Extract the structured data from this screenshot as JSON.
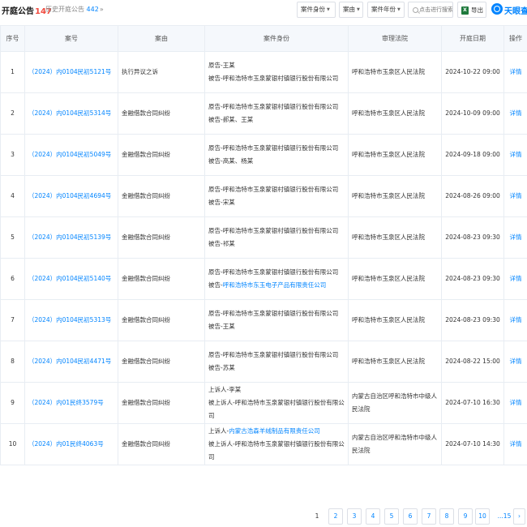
{
  "header": {
    "title": "开庭公告",
    "count": "147",
    "history_label": "历史开庭公告",
    "history_count": "442",
    "history_chevron": "»",
    "filters": [
      {
        "label": "案件身份"
      },
      {
        "label": "案由"
      },
      {
        "label": "案件年份"
      }
    ],
    "search_placeholder": "点击进行搜索",
    "export_label": "导出",
    "export_icon": "excel-icon",
    "logo_text": "天眼查",
    "accent_color": "#0084ff",
    "count_color": "#f04a3e"
  },
  "table": {
    "columns": [
      "序号",
      "案号",
      "案由",
      "案件身份",
      "审理法院",
      "开庭日期",
      "操作"
    ],
    "rows": [
      {
        "index": "1",
        "case_no": "（2024）内0104民初5121号",
        "cause": "执行异议之诉",
        "parties": [
          {
            "role": "原告-王某",
            "entity": ""
          },
          {
            "role": "被告-呼和浩特市玉泉蒙银村镇银行股份有限公司",
            "entity": ""
          }
        ],
        "court": "呼和浩特市玉泉区人民法院",
        "date": "2024-10-22 09:00",
        "action": "详情"
      },
      {
        "index": "2",
        "case_no": "（2024）内0104民初5314号",
        "cause": "金融借款合同纠纷",
        "parties": [
          {
            "role": "原告-呼和浩特市玉泉蒙银村镇银行股份有限公司",
            "entity": ""
          },
          {
            "role": "被告-郝某、王某",
            "entity": ""
          }
        ],
        "court": "呼和浩特市玉泉区人民法院",
        "date": "2024-10-09 09:00",
        "action": "详情"
      },
      {
        "index": "3",
        "case_no": "（2024）内0104民初5049号",
        "cause": "金融借款合同纠纷",
        "parties": [
          {
            "role": "原告-呼和浩特市玉泉蒙银村镇银行股份有限公司",
            "entity": ""
          },
          {
            "role": "被告-高某、杨某",
            "entity": ""
          }
        ],
        "court": "呼和浩特市玉泉区人民法院",
        "date": "2024-09-18 09:00",
        "action": "详情"
      },
      {
        "index": "4",
        "case_no": "（2024）内0104民初4694号",
        "cause": "金融借款合同纠纷",
        "parties": [
          {
            "role": "原告-呼和浩特市玉泉蒙银村镇银行股份有限公司",
            "entity": ""
          },
          {
            "role": "被告-宋某",
            "entity": ""
          }
        ],
        "court": "呼和浩特市玉泉区人民法院",
        "date": "2024-08-26 09:00",
        "action": "详情"
      },
      {
        "index": "5",
        "case_no": "（2024）内0104民初5139号",
        "cause": "金融借款合同纠纷",
        "parties": [
          {
            "role": "原告-呼和浩特市玉泉蒙银村镇银行股份有限公司",
            "entity": ""
          },
          {
            "role": "被告-祁某",
            "entity": ""
          }
        ],
        "court": "呼和浩特市玉泉区人民法院",
        "date": "2024-08-23 09:30",
        "action": "详情"
      },
      {
        "index": "6",
        "case_no": "（2024）内0104民初5140号",
        "cause": "金融借款合同纠纷",
        "parties": [
          {
            "role": "原告-呼和浩特市玉泉蒙银村镇银行股份有限公司",
            "entity": ""
          },
          {
            "role": "被告-",
            "entity": "呼和浩特市东玉电子产品有限责任公司"
          }
        ],
        "court": "呼和浩特市玉泉区人民法院",
        "date": "2024-08-23 09:30",
        "action": "详情"
      },
      {
        "index": "7",
        "case_no": "（2024）内0104民初5313号",
        "cause": "金融借款合同纠纷",
        "parties": [
          {
            "role": "原告-呼和浩特市玉泉蒙银村镇银行股份有限公司",
            "entity": ""
          },
          {
            "role": "被告-王某",
            "entity": ""
          }
        ],
        "court": "呼和浩特市玉泉区人民法院",
        "date": "2024-08-23 09:30",
        "action": "详情"
      },
      {
        "index": "8",
        "case_no": "（2024）内0104民初4471号",
        "cause": "金融借款合同纠纷",
        "parties": [
          {
            "role": "原告-呼和浩特市玉泉蒙银村镇银行股份有限公司",
            "entity": ""
          },
          {
            "role": "被告-苏某",
            "entity": ""
          }
        ],
        "court": "呼和浩特市玉泉区人民法院",
        "date": "2024-08-22 15:00",
        "action": "详情"
      },
      {
        "index": "9",
        "case_no": "（2024）内01民终3579号",
        "cause": "金融借款合同纠纷",
        "parties": [
          {
            "role": "上诉人-李某",
            "entity": ""
          },
          {
            "role": "被上诉人-呼和浩特市玉泉蒙银村镇银行股份有限公司",
            "entity": ""
          }
        ],
        "court": "内蒙古自治区呼和浩特市中级人民法院",
        "date": "2024-07-10 16:30",
        "action": "详情"
      },
      {
        "index": "10",
        "case_no": "（2024）内01民终4063号",
        "cause": "金融借款合同纠纷",
        "parties": [
          {
            "role": "上诉人-",
            "entity": "内蒙古浩森羊绒制品有限责任公司"
          },
          {
            "role": "被上诉人-呼和浩特市玉泉蒙银村镇银行股份有限公司",
            "entity": ""
          }
        ],
        "court": "内蒙古自治区呼和浩特市中级人民法院",
        "date": "2024-07-10 14:30",
        "action": "详情"
      }
    ]
  },
  "pagination": {
    "pages": [
      "1",
      "2",
      "3",
      "4",
      "5",
      "6",
      "7",
      "8",
      "9",
      "10",
      "...15"
    ],
    "current": "1",
    "next_icon": "chevron-right-icon",
    "next_glyph": "›"
  }
}
